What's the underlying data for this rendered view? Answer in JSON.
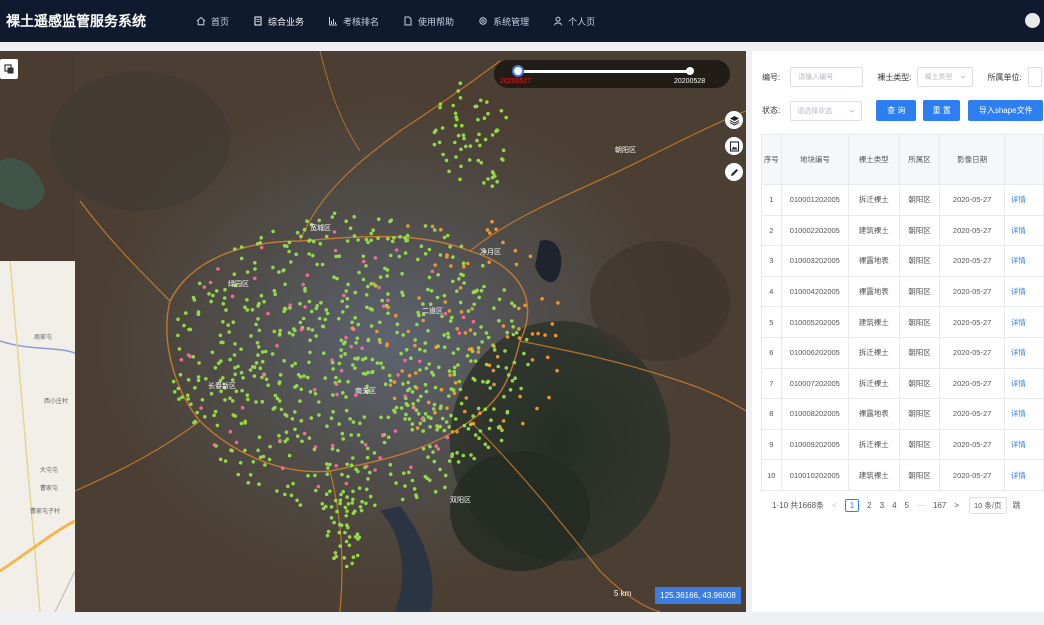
{
  "app": {
    "title": "裸土遥感监管服务系统"
  },
  "nav": [
    {
      "label": "首页",
      "icon": "home-icon",
      "active": false
    },
    {
      "label": "综合业务",
      "icon": "document-icon",
      "active": true
    },
    {
      "label": "考核排名",
      "icon": "bar-chart-icon",
      "active": false
    },
    {
      "label": "使用帮助",
      "icon": "help-document-icon",
      "active": false
    },
    {
      "label": "系统管理",
      "icon": "gear-icon",
      "active": false
    },
    {
      "label": "个人页",
      "icon": "user-icon",
      "active": false
    }
  ],
  "map": {
    "slider": {
      "start_date": "20200527",
      "end_date": "20200528"
    },
    "scale": "5 km",
    "coordinates": "125.36166, 43.96008",
    "district_labels": [
      "朝阳区",
      "二道区",
      "南关区",
      "宽城区",
      "绿园区",
      "净月区",
      "双阳区",
      "长春新区"
    ],
    "basemap_labels": [
      "周家屯",
      "西小庄村",
      "大屯屯",
      "曹家屯",
      "曹家屯子村"
    ],
    "colors": {
      "green_point": "#9be84a",
      "pink_point": "#ff6e9c",
      "orange_point": "#ff9f2e",
      "boundary": "#d6822a"
    }
  },
  "filters": {
    "code_label": "编号:",
    "code_placeholder": "请输入编号",
    "type_label": "裸土类型:",
    "type_placeholder": "裸土类型",
    "unit_label": "所属单位:",
    "status_label": "状态:",
    "status_placeholder": "请选择状态",
    "query_btn": "查 询",
    "reset_btn": "重 置",
    "import_btn": "导入shape文件"
  },
  "table": {
    "headers": [
      "序号",
      "地块编号",
      "裸土类型",
      "所属区",
      "影像日期",
      ""
    ],
    "rows": [
      [
        "1",
        "010001202005",
        "拆迁裸土",
        "朝阳区",
        "2020-05-27",
        "详情"
      ],
      [
        "2",
        "010002202005",
        "建筑裸土",
        "朝阳区",
        "2020-05-27",
        "详情"
      ],
      [
        "3",
        "010003202005",
        "裸露地表",
        "朝阳区",
        "2020-05-27",
        "详情"
      ],
      [
        "4",
        "010004202005",
        "裸露地表",
        "朝阳区",
        "2020-05-27",
        "详情"
      ],
      [
        "5",
        "010005202005",
        "建筑裸土",
        "朝阳区",
        "2020-05-27",
        "详情"
      ],
      [
        "6",
        "010006202005",
        "拆迁裸土",
        "朝阳区",
        "2020-05-27",
        "详情"
      ],
      [
        "7",
        "010007202005",
        "拆迁裸土",
        "朝阳区",
        "2020-05-27",
        "详情"
      ],
      [
        "8",
        "010008202005",
        "裸露地表",
        "朝阳区",
        "2020-05-27",
        "详情"
      ],
      [
        "9",
        "010009202005",
        "拆迁裸土",
        "朝阳区",
        "2020-05-27",
        "详情"
      ],
      [
        "10",
        "010010202005",
        "建筑裸土",
        "朝阳区",
        "2020-05-27",
        "详情"
      ]
    ]
  },
  "pager": {
    "summary": "1-10 共1668条",
    "prev": "<",
    "pages": [
      "1",
      "2",
      "3",
      "4",
      "5",
      "···",
      "167"
    ],
    "next": ">",
    "page_size": "10 条/页",
    "goto": "跳"
  }
}
